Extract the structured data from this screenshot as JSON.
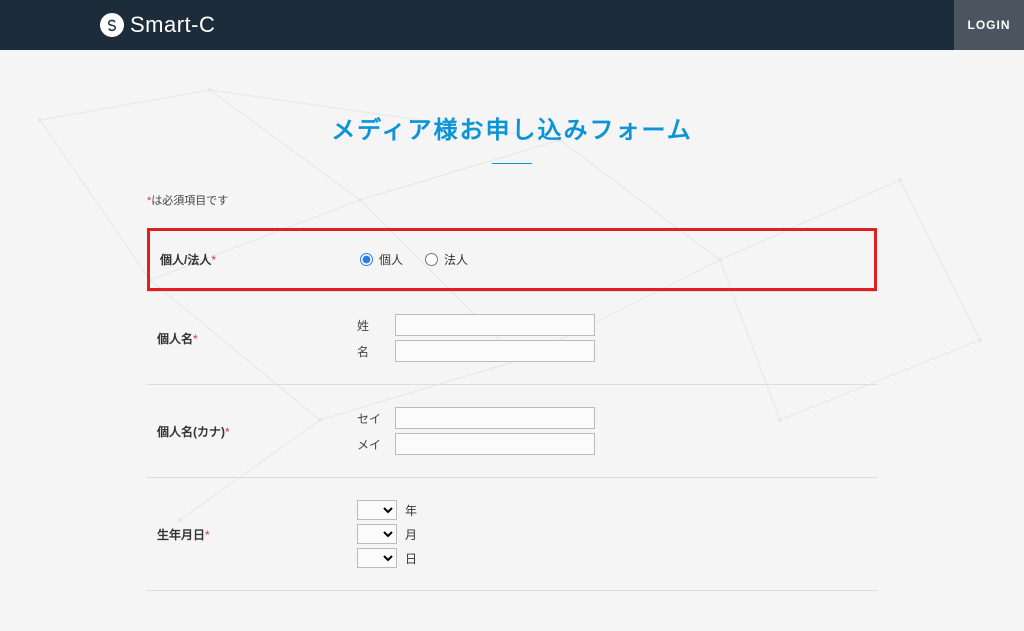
{
  "header": {
    "brand": "Smart-C",
    "login_label": "LOGIN"
  },
  "page": {
    "title": "メディア様お申し込みフォーム",
    "required_note_ast": "*",
    "required_note": "は必須項目です"
  },
  "form": {
    "entity": {
      "label": "個人/法人",
      "required_mark": "*",
      "options": {
        "personal": "個人",
        "corporate": "法人"
      }
    },
    "name": {
      "label": "個人名",
      "required_mark": "*",
      "family_label": "姓",
      "given_label": "名",
      "family_value": "",
      "given_value": ""
    },
    "kana": {
      "label": "個人名(カナ)",
      "required_mark": "*",
      "family_label": "セイ",
      "given_label": "メイ",
      "family_value": "",
      "given_value": ""
    },
    "dob": {
      "label": "生年月日",
      "required_mark": "*",
      "year_suffix": "年",
      "month_suffix": "月",
      "day_suffix": "日"
    }
  }
}
